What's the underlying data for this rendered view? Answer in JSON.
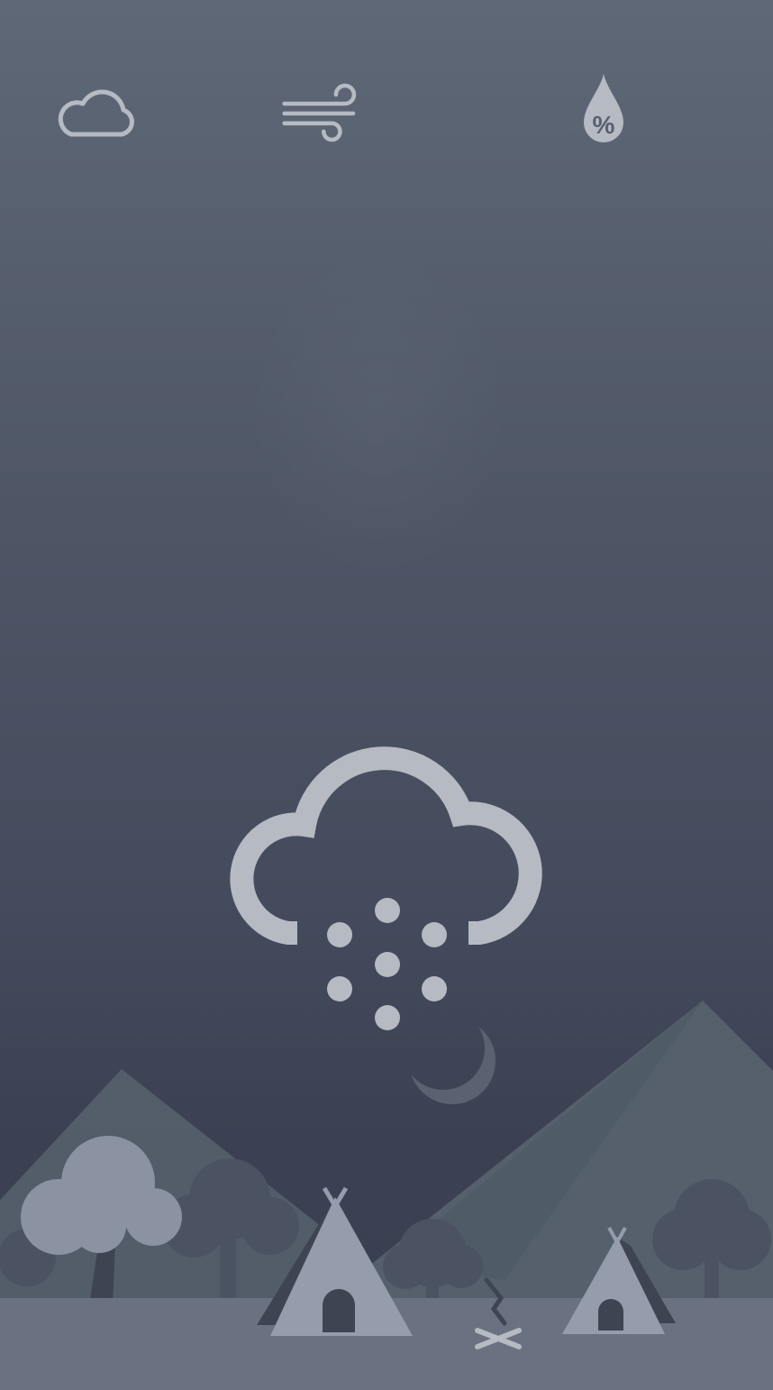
{
  "top_bar": {
    "icons": [
      "cloud-icon",
      "wind-icon",
      "humidity-drop-icon"
    ],
    "humidity_symbol": "%"
  },
  "condition": {
    "icon": "snow-cloud-icon",
    "moon_icon": "crescent-moon-icon"
  },
  "colors": {
    "background_top": "#5f6877",
    "background_bottom": "#3a4050",
    "icon_light": "#b6bac3",
    "mountain": "#56606d",
    "tree_dark": "#4b5262",
    "tree_light": "#8b93a2",
    "tent": "#959cab",
    "ground": "#6a7180"
  }
}
